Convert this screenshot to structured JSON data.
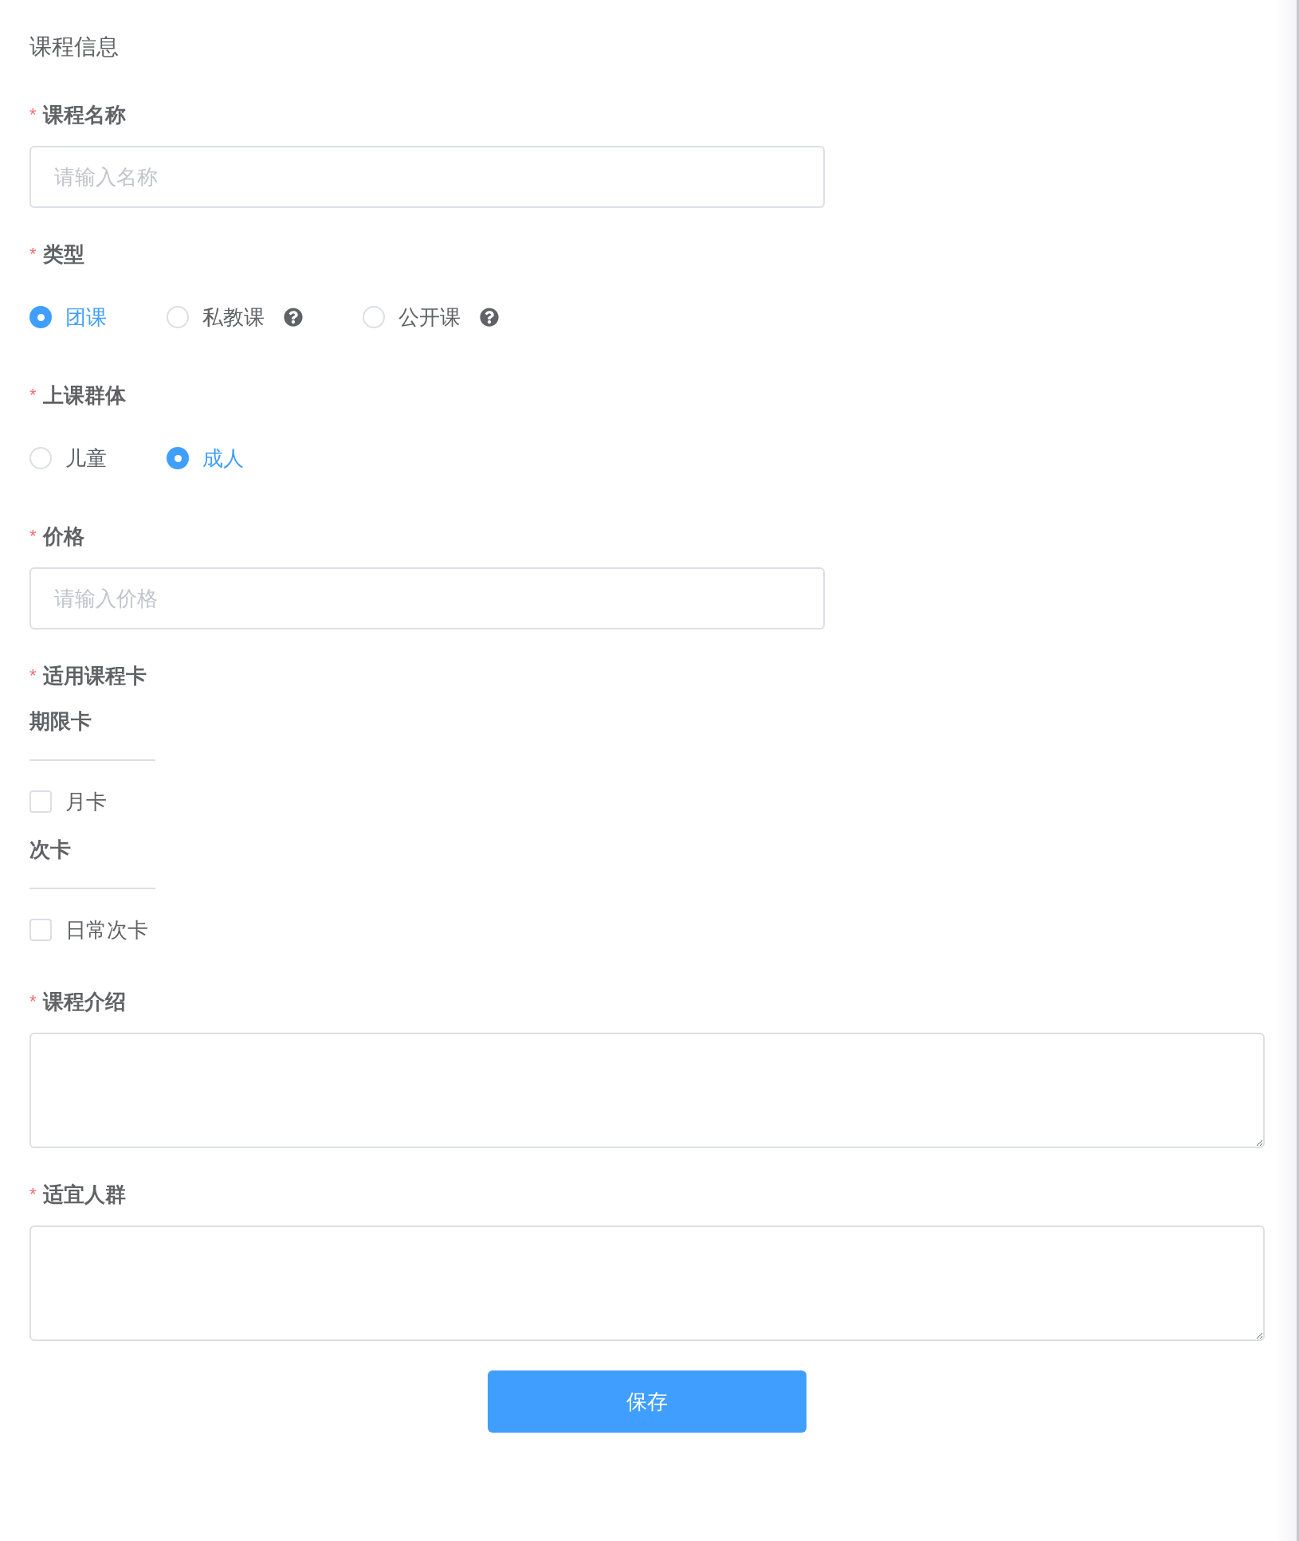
{
  "page_title": "课程信息",
  "fields": [
    {
      "kind": "input",
      "required_mark": "*",
      "label": "课程名称",
      "placeholder": "请输入名称"
    },
    {
      "kind": "radio",
      "required_mark": "*",
      "label": "类型",
      "options": [
        {
          "label": "团课",
          "selected": true,
          "help": false
        },
        {
          "label": "私教课",
          "selected": false,
          "help": true
        },
        {
          "label": "公开课",
          "selected": false,
          "help": true
        }
      ]
    },
    {
      "kind": "radio",
      "required_mark": "*",
      "label": "上课群体",
      "options": [
        {
          "label": "儿童",
          "selected": false,
          "help": false
        },
        {
          "label": "成人",
          "selected": true,
          "help": false
        }
      ]
    },
    {
      "kind": "input",
      "required_mark": "*",
      "label": "价格",
      "placeholder": "请输入价格"
    },
    {
      "kind": "cards",
      "required_mark": "*",
      "label": "适用课程卡",
      "groups": [
        {
          "title": "期限卡",
          "options": [
            {
              "label": "月卡",
              "checked": false
            }
          ]
        },
        {
          "title": "次卡",
          "options": [
            {
              "label": "日常次卡",
              "checked": false
            }
          ]
        }
      ]
    },
    {
      "kind": "textarea",
      "required_mark": "*",
      "label": "课程介绍"
    },
    {
      "kind": "textarea",
      "required_mark": "*",
      "label": "适宜人群"
    }
  ],
  "save_button": "保存"
}
